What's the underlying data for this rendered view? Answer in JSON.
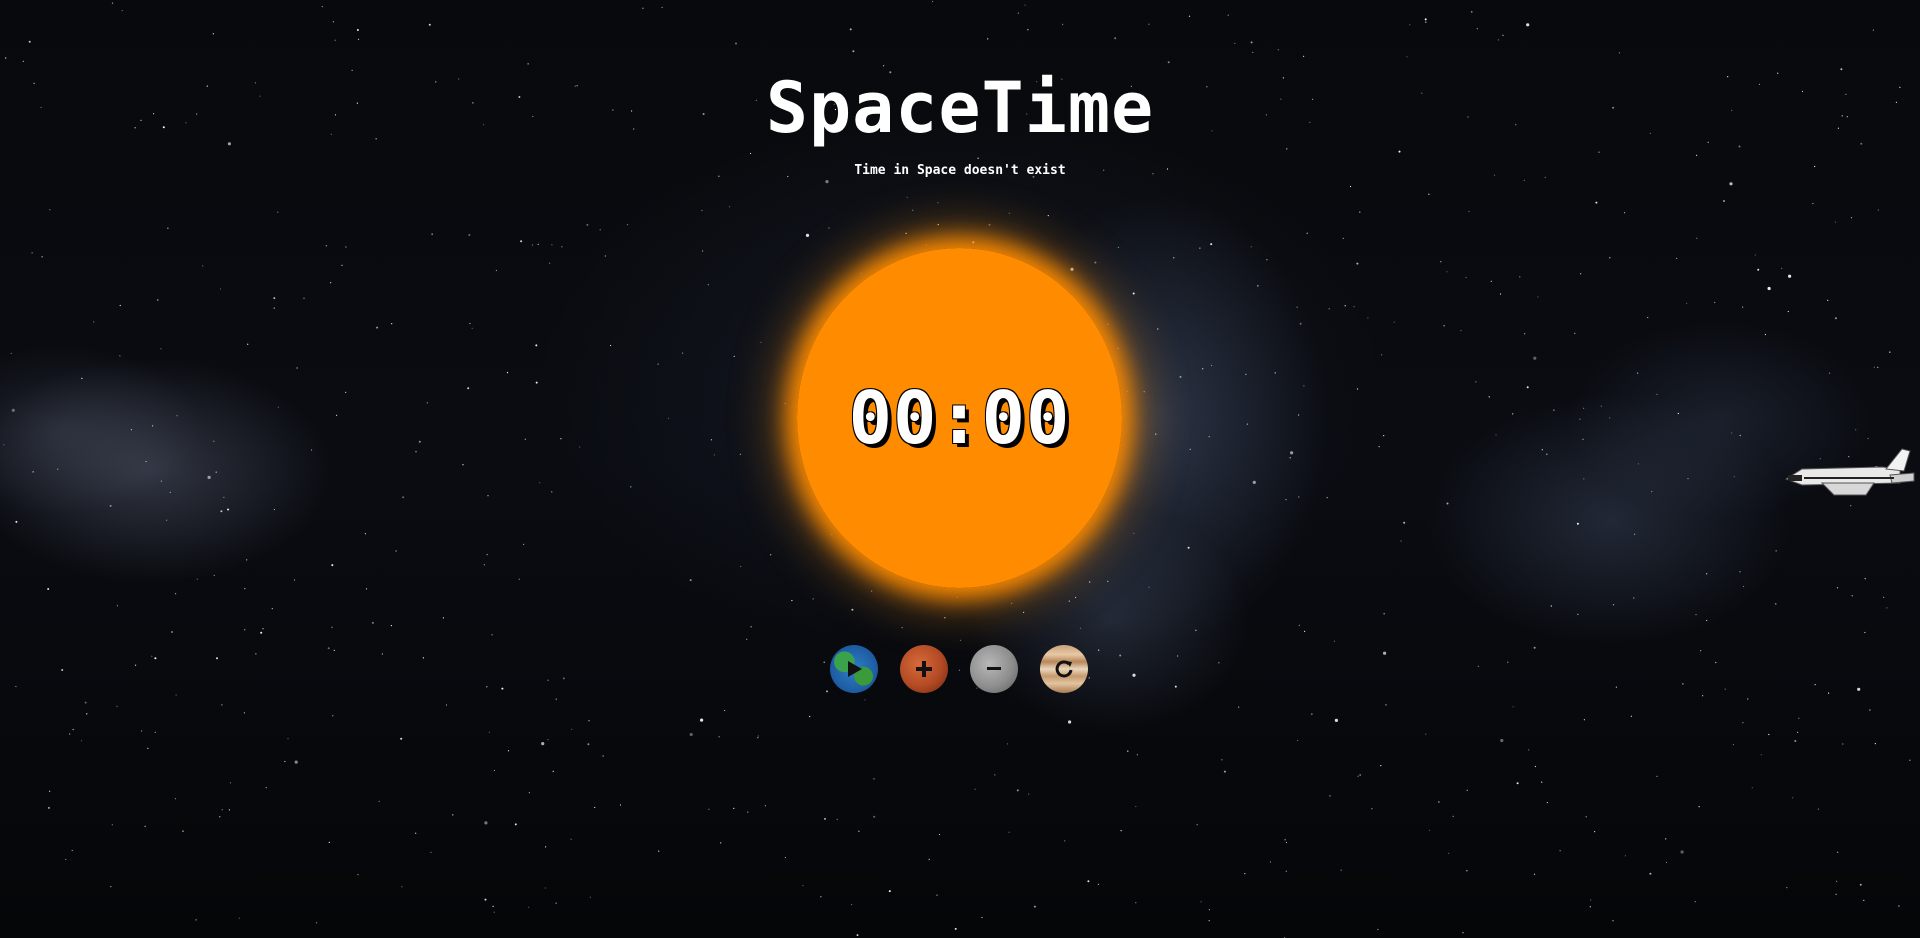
{
  "header": {
    "title": "SpaceTime",
    "tagline": "Time in Space doesn't exist"
  },
  "timer": {
    "display": "00:00"
  },
  "controls": [
    {
      "action": "play",
      "icon": "play-icon",
      "planet": "earth"
    },
    {
      "action": "increase",
      "icon": "plus-icon",
      "planet": "mars"
    },
    {
      "action": "decrease",
      "icon": "minus-icon",
      "planet": "moon"
    },
    {
      "action": "reset",
      "icon": "reset-icon",
      "planet": "jupiter"
    }
  ],
  "colors": {
    "sun": "#ff8c00",
    "text": "#ffffff",
    "background": "#050608"
  }
}
